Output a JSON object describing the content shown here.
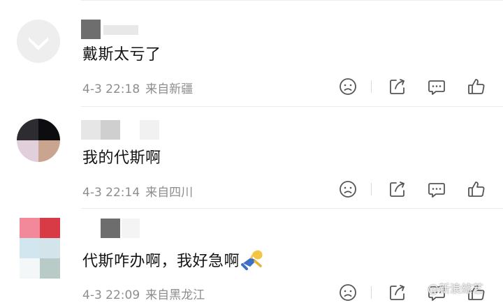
{
  "comments": [
    {
      "text": "戴斯太亏了",
      "time": "4-3 22:18",
      "location": "来自新疆"
    },
    {
      "text": "我的代斯啊",
      "time": "4-3 22:14",
      "location": "来自四川"
    },
    {
      "text": "代斯咋办啊，我好急啊",
      "time": "4-3 22:09",
      "location": "来自黑龙江"
    }
  ],
  "icons": {
    "dislike": "frown-face-icon",
    "share": "share-icon",
    "reply": "comment-bubble-icon",
    "like": "thumbs-up-icon",
    "emoji": "running-figure-emoji"
  },
  "colors": {
    "meta": "#8d8d8d",
    "icon": "#555555",
    "divider": "#ebebeb"
  },
  "watermark": "@新浪综艺"
}
